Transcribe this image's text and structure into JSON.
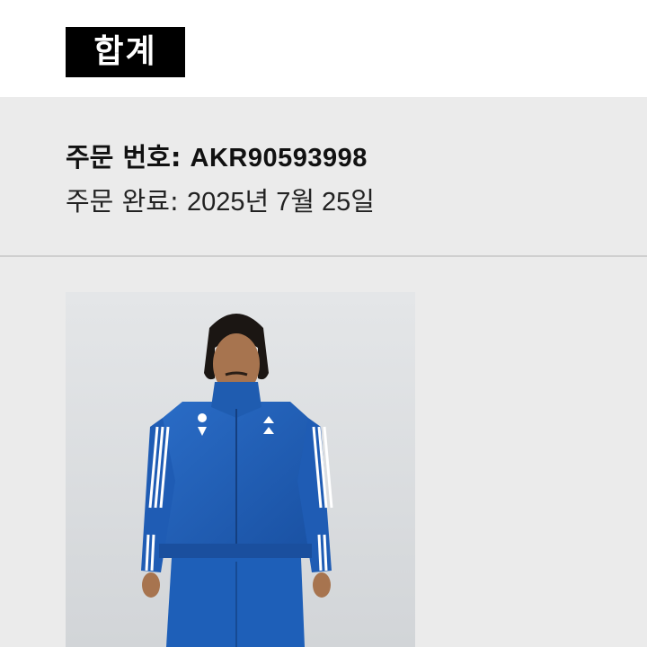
{
  "header": {
    "total_label": "합계"
  },
  "order": {
    "number_label": "주문 번호:",
    "number_value": "AKR90593998",
    "completed_label": "주문 완료:",
    "completed_value": "2025년 7월 25일"
  },
  "product": {
    "image_icon": "product-photo-icon"
  },
  "colors": {
    "background": "#ebebeb",
    "badge": "#000000",
    "jacket_blue": "#1e5fb8"
  }
}
